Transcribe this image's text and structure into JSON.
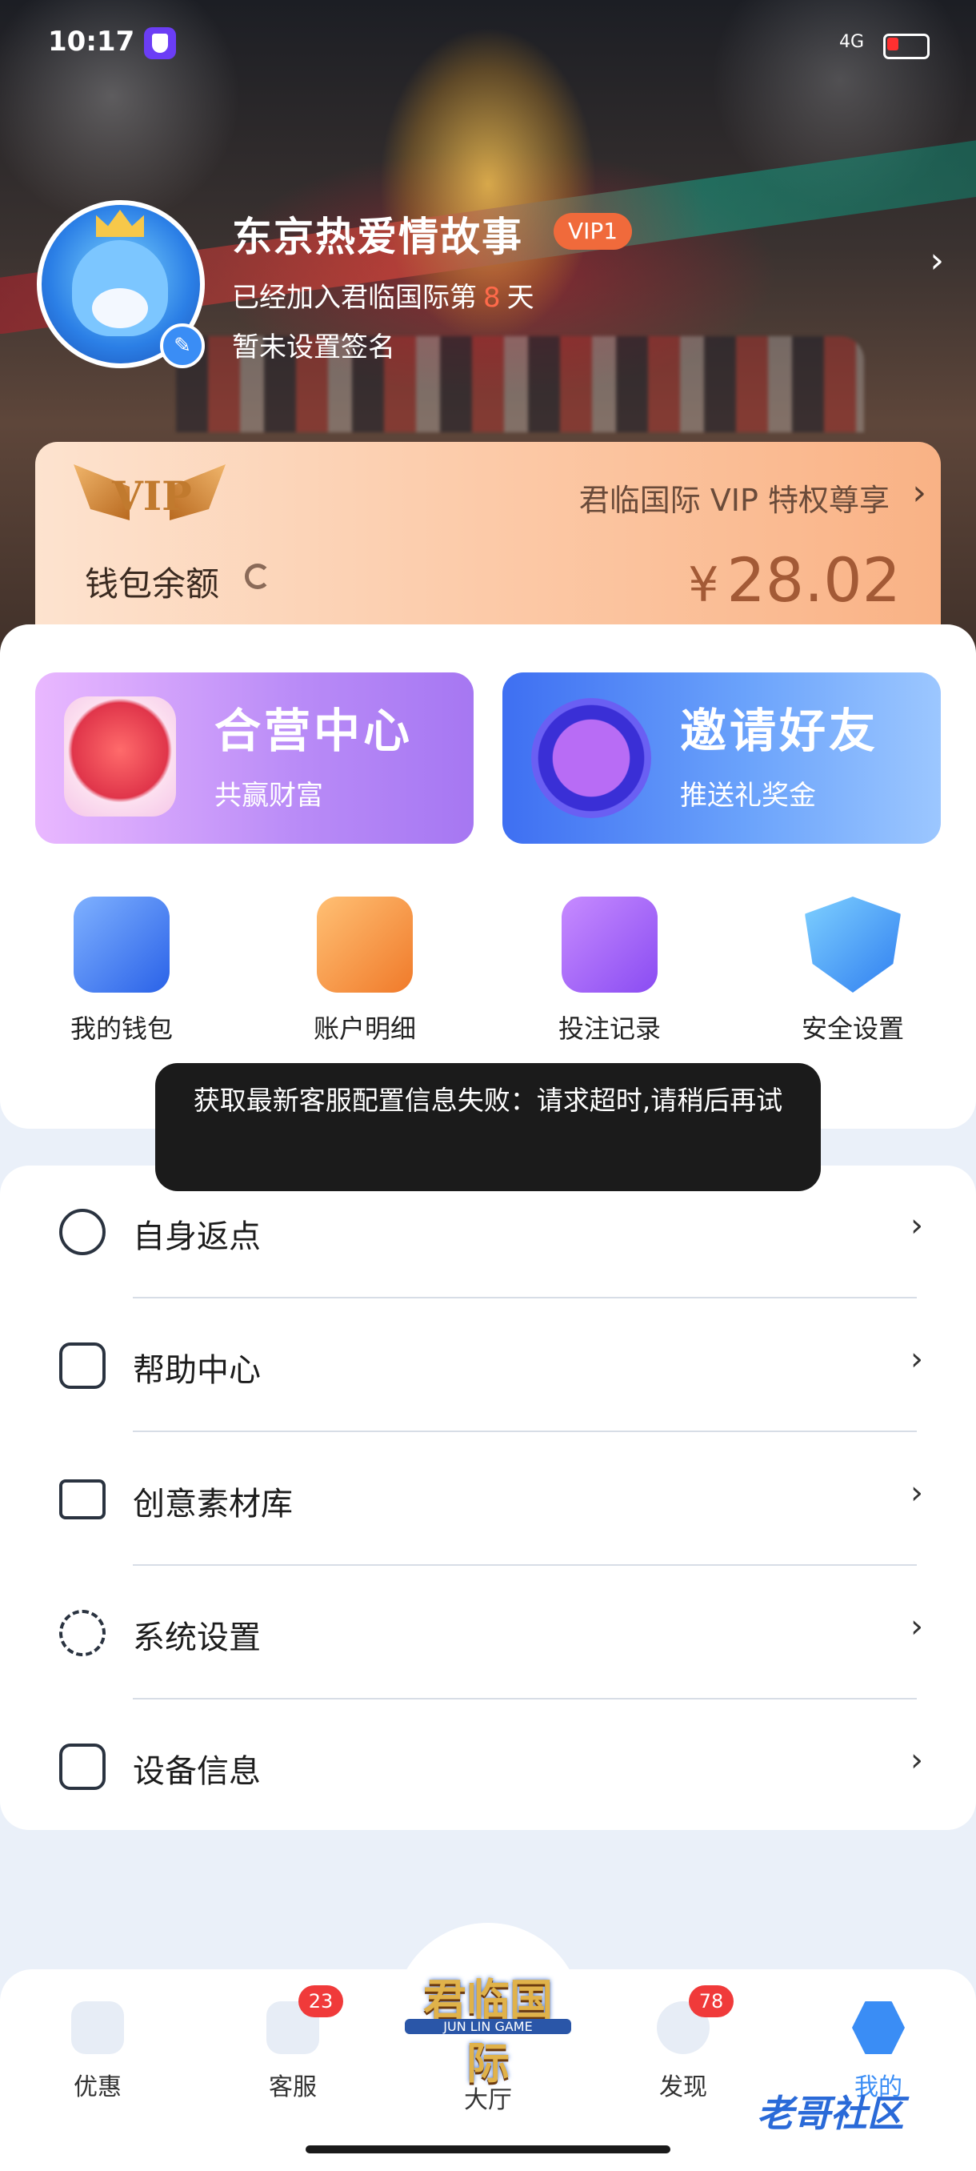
{
  "status": {
    "time": "10:17",
    "network": "4G"
  },
  "profile": {
    "username": "东京热爱情故事",
    "vip_level": "VIP1",
    "joined_prefix": "已经加入君临国际第",
    "joined_days": "8",
    "joined_suffix": "天",
    "signature": "暂未设置签名"
  },
  "vip_card": {
    "logo_text": "VIP",
    "privilege_text": "君临国际 VIP 特权尊享",
    "wallet_label": "钱包余额",
    "currency": "¥",
    "balance": "28.02"
  },
  "promos": [
    {
      "title": "合营中心",
      "subtitle": "共赢财富"
    },
    {
      "title": "邀请好友",
      "subtitle": "推送礼奖金"
    }
  ],
  "shortcuts": [
    {
      "label": "我的钱包"
    },
    {
      "label": "账户明细"
    },
    {
      "label": "投注记录"
    },
    {
      "label": "安全设置"
    }
  ],
  "toast": "获取最新客服配置信息失败：请求超时,请稍后再试",
  "menu": [
    {
      "label": "自身返点",
      "icon": "percent-gear-icon"
    },
    {
      "label": "帮助中心",
      "icon": "question-icon"
    },
    {
      "label": "创意素材库",
      "icon": "folder-icon"
    },
    {
      "label": "系统设置",
      "icon": "settings-icon"
    },
    {
      "label": "设备信息",
      "icon": "device-icon"
    }
  ],
  "nav": {
    "items": [
      {
        "label": "优惠"
      },
      {
        "label": "客服",
        "badge": "23"
      },
      {
        "label": "大厅"
      },
      {
        "label": "发现",
        "badge": "78"
      },
      {
        "label": "我的"
      }
    ],
    "hall_logo": "君临国际",
    "hall_logo_sub": "JUN LIN GAME"
  },
  "watermark": "老哥社区",
  "colors": {
    "accent": "#3a8df5",
    "vip_badge": "#f06a3b",
    "badge": "#f03a3a",
    "balance": "#a35a36"
  }
}
